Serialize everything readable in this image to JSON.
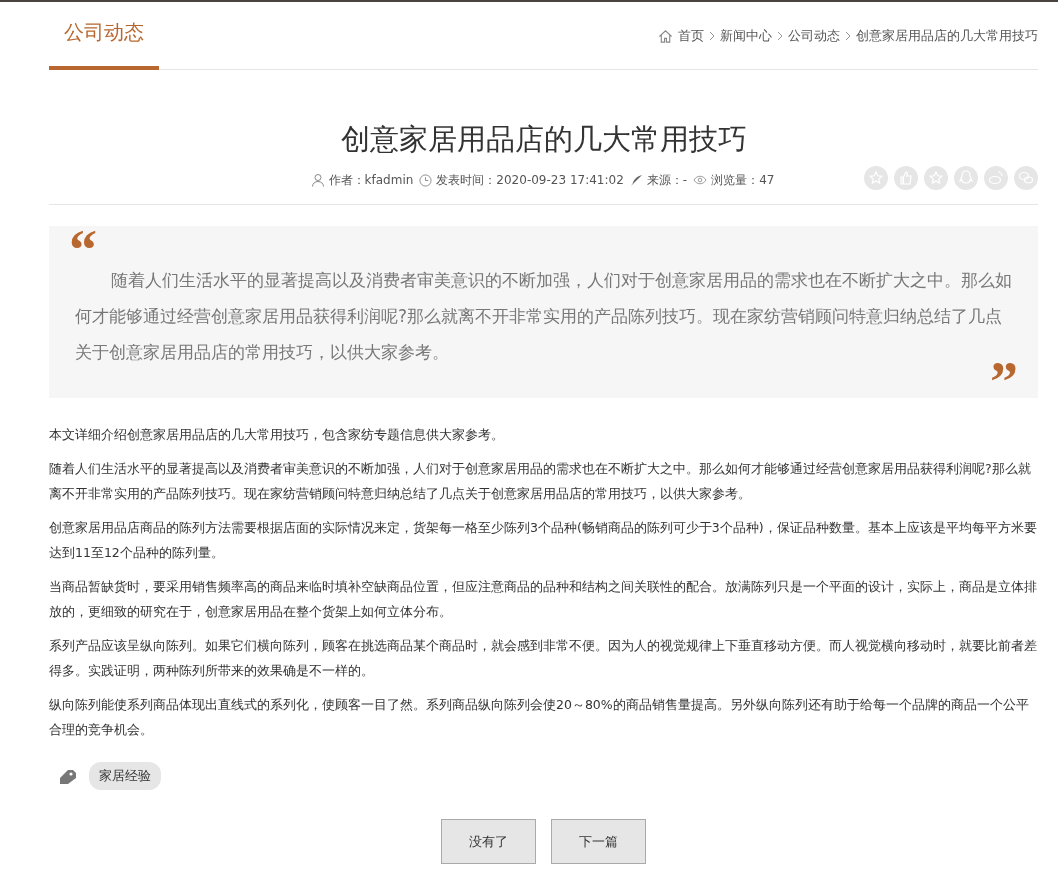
{
  "section_tab": {
    "label": "公司动态",
    "selected": true
  },
  "breadcrumb": [
    "首页",
    "新闻中心",
    "公司动态",
    "创意家居用品店的几大常用技巧"
  ],
  "article": {
    "title": "创意家居用品店的几大常用技巧",
    "meta": [
      {
        "kind": "author",
        "text": "作者：kfadmin"
      },
      {
        "kind": "time",
        "text": "发表时间：2020-09-23 17:41:02"
      },
      {
        "kind": "source",
        "text": "来源：-"
      },
      {
        "kind": "views",
        "text": "浏览量：47"
      }
    ],
    "share_icons": [
      {
        "kind": "star"
      },
      {
        "kind": "thumb"
      },
      {
        "kind": "star"
      },
      {
        "kind": "qq"
      },
      {
        "kind": "weibo"
      },
      {
        "kind": "wechat"
      }
    ],
    "quote": {
      "open": "“",
      "text": "随着人们生活水平的显著提高以及消费者审美意识的不断加强，人们对于创意家居用品的需求也在不断扩大之中。那么如何才能够通过经营创意家居用品获得利润呢?那么就离不开非常实用的产品陈列技巧。现在家纺营销顾问特意归纳总结了几点关于创意家居用品店的常用技巧，以供大家参考。",
      "close": "”"
    },
    "paragraphs": [
      "本文详细介绍创意家居用品店的几大常用技巧，包含家纺专题信息供大家参考。",
      "随着人们生活水平的显著提高以及消费者审美意识的不断加强，人们对于创意家居用品的需求也在不断扩大之中。那么如何才能够通过经营创意家居用品获得利润呢?那么就离不开非常实用的产品陈列技巧。现在家纺营销顾问特意归纳总结了几点关于创意家居用品店的常用技巧，以供大家参考。",
      "创意家居用品店商品的陈列方法需要根据店面的实际情况来定，货架每一格至少陈列3个品种(畅销商品的陈列可少于3个品种)，保证品种数量。基本上应该是平均每平方米要达到11至12个品种的陈列量。",
      "当商品暂缺货时，要采用销售频率高的商品来临时填补空缺商品位置，但应注意商品的品种和结构之间关联性的配合。放满陈列只是一个平面的设计，实际上，商品是立体排放的，更细致的研究在于，创意家居用品在整个货架上如何立体分布。",
      "系列产品应该呈纵向陈列。如果它们横向陈列，顾客在挑选商品某个商品时，就会感到非常不便。因为人的视觉规律上下垂直移动方便。而人视觉横向移动时，就要比前者差得多。实践证明，两种陈列所带来的效果确是不一样的。",
      "纵向陈列能使系列商品体现出直线式的系列化，使顾客一目了然。系列商品纵向陈列会使20～80%的商品销售量提高。另外纵向陈列还有助于给每一个品牌的商品一个公平合理的竞争机会。"
    ],
    "tags": [
      "家居经验"
    ]
  },
  "pager": [
    "没有了",
    "下一篇"
  ]
}
